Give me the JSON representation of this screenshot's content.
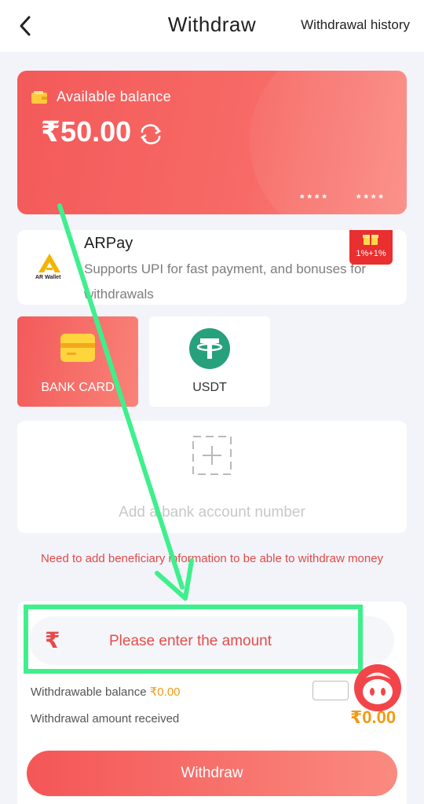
{
  "header": {
    "title": "Withdraw",
    "history_link": "Withdrawal history"
  },
  "balance_card": {
    "label": "Available balance",
    "amount": "₹50.00",
    "masked_left": "****",
    "masked_right": "****"
  },
  "arpay": {
    "logo_text": "AR Wallet",
    "name": "ARPay",
    "description": "Supports UPI for fast payment, and bonuses for withdrawals",
    "badge": "1%+1%"
  },
  "methods": [
    {
      "label": "BANK CARD",
      "selected": true
    },
    {
      "label": "USDT",
      "selected": false
    }
  ],
  "add_account": {
    "label": "Add a bank account number"
  },
  "warning": "Need to add beneficiary information to be able to withdraw money",
  "amount": {
    "currency_symbol": "₹",
    "placeholder": "Please enter the amount",
    "value": ""
  },
  "withdrawable": {
    "label": "Withdrawable balance ",
    "value": "₹0.00"
  },
  "received": {
    "label": "Withdrawal amount received",
    "value": "₹0.00"
  },
  "withdraw_button": "Withdraw",
  "colors": {
    "accent": "#f35a5a",
    "annotation_green": "#3ef08c",
    "amount_orange": "#f29a13"
  }
}
